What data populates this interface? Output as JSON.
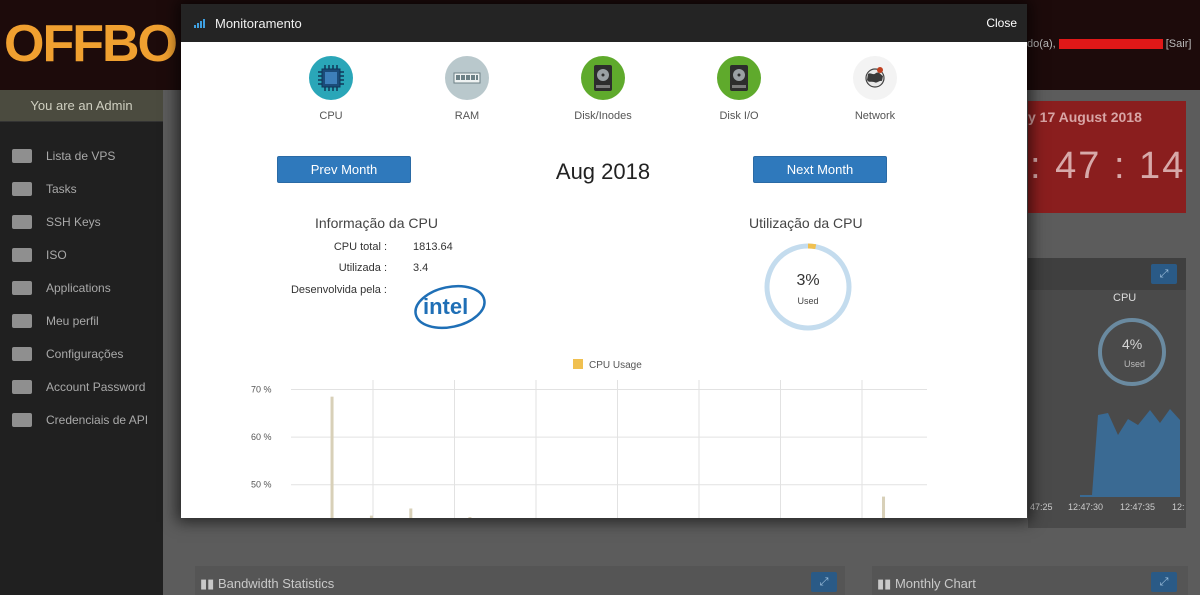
{
  "app": {
    "logo_text": "OFFBO",
    "user_text": "do(a),",
    "logout_label": "[Sair]",
    "admin_label": "You are an Admin",
    "sidebar": [
      {
        "label": "Lista de VPS",
        "icon": "monitor-icon"
      },
      {
        "label": "Tasks",
        "icon": "tasks-icon"
      },
      {
        "label": "SSH Keys",
        "icon": "lock-icon"
      },
      {
        "label": "ISO",
        "icon": "drive-icon"
      },
      {
        "label": "Applications",
        "icon": "drive-icon"
      },
      {
        "label": "Meu perfil",
        "icon": "briefcase-icon"
      },
      {
        "label": "Configurações",
        "icon": "wrench-icon"
      },
      {
        "label": "Account Password",
        "icon": "key-icon"
      },
      {
        "label": "Credenciais de API",
        "icon": "tags-icon"
      }
    ],
    "clock": {
      "date": "y 17 August 2018",
      "time": ": 47 : 14"
    },
    "mini_cpu": {
      "title": "CPU",
      "value": "4%",
      "used": "Used"
    },
    "mini_times": [
      "47:25",
      "12:47:30",
      "12:47:35",
      "12:"
    ],
    "bottom_panels": [
      {
        "title": "Bandwidth Statistics"
      },
      {
        "title": "Monthly Chart"
      }
    ]
  },
  "modal": {
    "title": "Monitoramento",
    "close_label": "Close",
    "tabs": [
      {
        "label": "CPU",
        "icon": "cpu-icon",
        "color": "#2aa6b8"
      },
      {
        "label": "RAM",
        "icon": "ram-icon",
        "color": "#b9c8cc"
      },
      {
        "label": "Disk/Inodes",
        "icon": "hard-disk-icon",
        "color": "#5faa2c"
      },
      {
        "label": "Disk I/O",
        "icon": "hard-disk-io-icon",
        "color": "#5faa2c"
      },
      {
        "label": "Network",
        "icon": "network-globe-icon",
        "color": "#f3f3f3"
      }
    ],
    "prev_month_label": "Prev Month",
    "next_month_label": "Next Month",
    "month_label": "Aug 2018",
    "info": {
      "title": "Informação da CPU",
      "rows": [
        {
          "label": "CPU total :",
          "value": "1813.64"
        },
        {
          "label": "Utilizada :",
          "value": "3.4"
        },
        {
          "label": "Desenvolvida pela :",
          "value": ""
        }
      ],
      "vendor_logo_text": "intel"
    },
    "utilization": {
      "title": "Utilização da CPU",
      "percent": 3,
      "value_text": "3%",
      "used_label": "Used"
    }
  },
  "chart_data": {
    "type": "bar",
    "series": [
      {
        "name": "CPU Usage",
        "color": "#f0c050"
      }
    ],
    "y_ticks": [
      "70 %",
      "60 %",
      "50 %"
    ],
    "y_tick_values": [
      70,
      60,
      50
    ],
    "ylim_visible": [
      43,
      72
    ],
    "bars": [
      {
        "day": 2,
        "value": 68.5
      },
      {
        "day": 4,
        "value": 43.5
      },
      {
        "day": 6,
        "value": 45
      },
      {
        "day": 9,
        "value": 43.2
      },
      {
        "day": 30,
        "value": 47.5
      }
    ]
  }
}
